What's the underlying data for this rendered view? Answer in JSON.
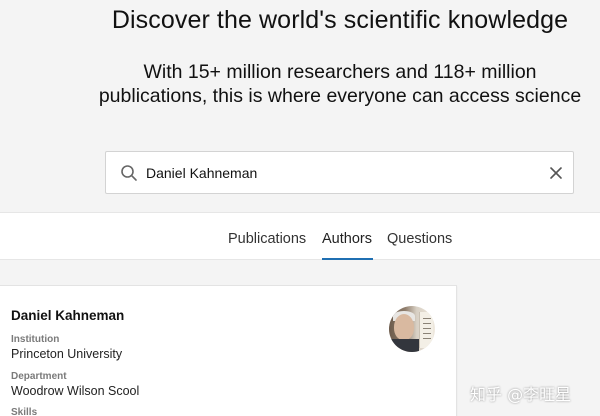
{
  "hero": {
    "title": "Discover the world's scientific knowledge",
    "subtitle_line1": "With 15+ million researchers and 118+ million",
    "subtitle_line2": "publications, this is where everyone can access science"
  },
  "search": {
    "value": "Daniel Kahneman",
    "search_icon": "search-icon",
    "clear_icon": "close-icon"
  },
  "tabs": [
    {
      "label": "Publications",
      "active": false
    },
    {
      "label": "Authors",
      "active": true
    },
    {
      "label": "Questions",
      "active": false
    }
  ],
  "result_card": {
    "name": "Daniel Kahneman",
    "institution_label": "Institution",
    "institution": "Princeton University",
    "department_label": "Department",
    "department": "Woodrow Wilson Scool",
    "skills_label": "Skills"
  },
  "watermark": "知乎 @李旺星",
  "colors": {
    "accent": "#1f6fb2",
    "background": "#f4f4f4"
  }
}
